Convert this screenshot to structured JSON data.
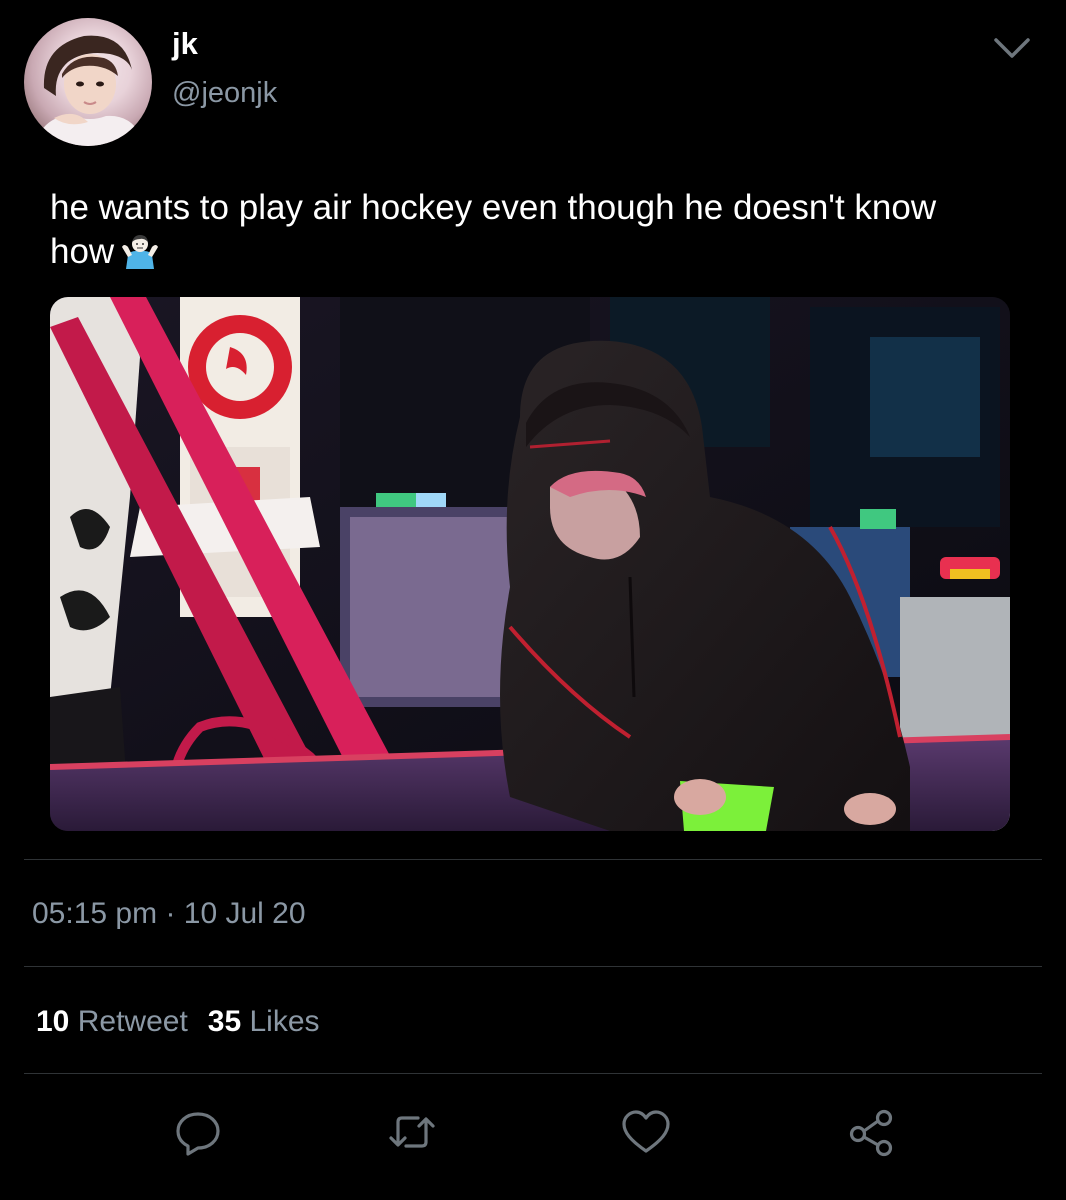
{
  "user": {
    "display_name": "jk",
    "handle": "@jeonjk"
  },
  "tweet": {
    "text": "he wants to play air hockey even though he doesn't know how",
    "emoji": "man-shrugging-emoji"
  },
  "meta": {
    "time": "05:15 pm",
    "separator": "·",
    "date": "10 Jul 20"
  },
  "stats": {
    "retweets_count": "10",
    "retweets_label": "Retweet",
    "likes_count": "35",
    "likes_label": "Likes"
  },
  "actions": [
    {
      "name": "reply",
      "icon": "comment-icon"
    },
    {
      "name": "retweet",
      "icon": "retweet-icon"
    },
    {
      "name": "like",
      "icon": "heart-icon"
    },
    {
      "name": "share",
      "icon": "share-icon"
    }
  ],
  "colors": {
    "background": "#000000",
    "text_primary": "#ffffff",
    "text_secondary": "#8b98a5",
    "divider": "#2f3336"
  }
}
